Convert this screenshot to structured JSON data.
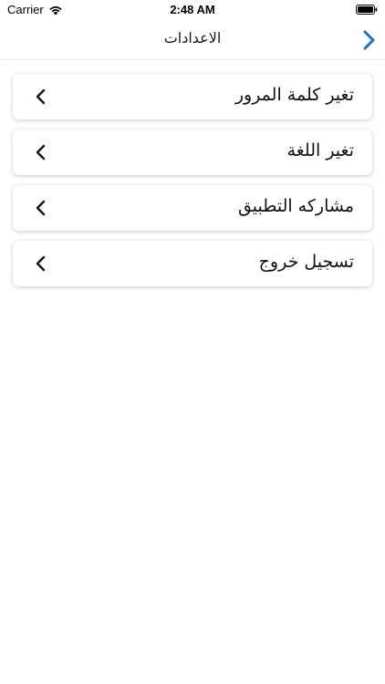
{
  "status_bar": {
    "carrier": "Carrier",
    "time": "2:48 AM",
    "wifi_icon": "wifi-icon",
    "battery_icon": "battery-icon"
  },
  "nav": {
    "title": "الاعدادات",
    "back_icon": "chevron-right-icon",
    "accent_color": "#1a73c9"
  },
  "settings": {
    "items": [
      {
        "label": "تغير كلمة المرور",
        "icon": "chevron-left-icon"
      },
      {
        "label": "تغير اللغة",
        "icon": "chevron-left-icon"
      },
      {
        "label": "مشاركه التطبيق",
        "icon": "chevron-left-icon"
      },
      {
        "label": "تسجيل خروج",
        "icon": "chevron-left-icon"
      }
    ]
  }
}
